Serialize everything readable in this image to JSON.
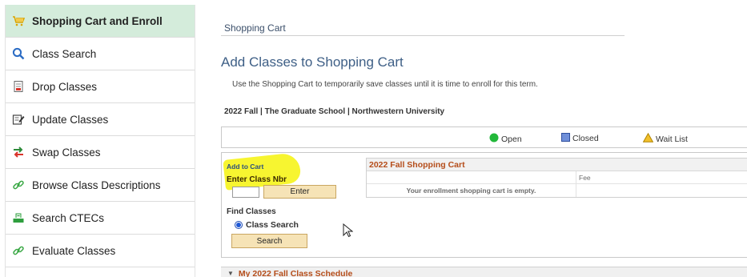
{
  "sidebar": {
    "items": [
      {
        "label": "Shopping Cart and Enroll",
        "icon": "shopping-cart-icon",
        "active": true
      },
      {
        "label": "Class Search",
        "icon": "magnifier-icon",
        "active": false
      },
      {
        "label": "Drop Classes",
        "icon": "drop-document-icon",
        "active": false
      },
      {
        "label": "Update Classes",
        "icon": "edit-document-icon",
        "active": false
      },
      {
        "label": "Swap Classes",
        "icon": "swap-arrows-icon",
        "active": false
      },
      {
        "label": "Browse Class Descriptions",
        "icon": "link-chain-icon",
        "active": false
      },
      {
        "label": "Search CTECs",
        "icon": "green-tray-icon",
        "active": false
      },
      {
        "label": "Evaluate Classes",
        "icon": "link-chain-icon",
        "active": false
      }
    ]
  },
  "main": {
    "breadcrumb": "Shopping Cart",
    "title": "Add Classes to Shopping Cart",
    "instructions": "Use the Shopping Cart to temporarily save classes until it is time to enroll for this term.",
    "term": "2022 Fall | The Graduate School | Northwestern University",
    "legend": {
      "open": "Open",
      "closed": "Closed",
      "wait_list": "Wait List"
    },
    "add_to_cart": {
      "heading": "Add to Cart",
      "enter_label": "Enter Class Nbr",
      "input_value": "",
      "enter_button": "Enter"
    },
    "find_classes": {
      "heading": "Find Classes",
      "radio_label": "Class Search",
      "search_button": "Search"
    },
    "cart": {
      "title": "2022 Fall Shopping Cart",
      "column_fee": "Fee",
      "empty_message": "Your enrollment shopping cart is empty."
    },
    "schedule_heading": "My 2022 Fall Class Schedule"
  },
  "colors": {
    "active_item_bg": "#d4ecdb",
    "title_blue": "#3e5f86",
    "cart_title_orange": "#b54d1a",
    "button_tan": "#f6e3b6",
    "highlight_yellow": "#f7f530",
    "open_green": "#22b83a",
    "closed_blue": "#6f8fd9",
    "wait_yellow": "#f2c02b"
  }
}
